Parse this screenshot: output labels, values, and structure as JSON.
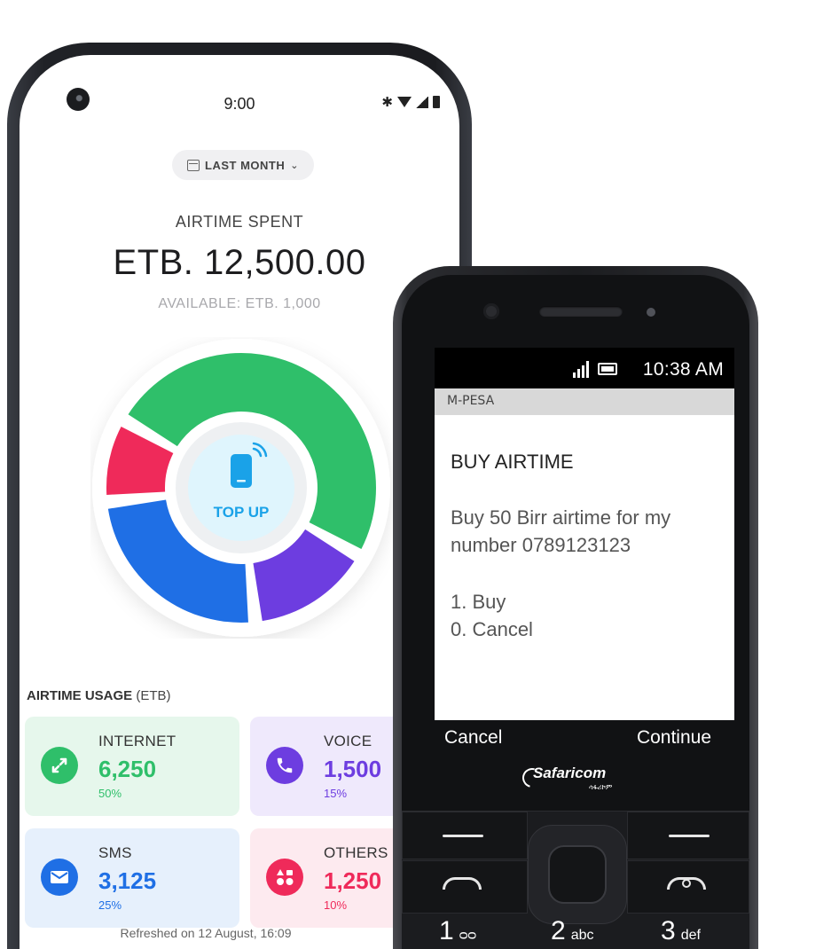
{
  "phone": {
    "status_time": "9:00",
    "period_label": "LAST MONTH",
    "spent_label": "AIRTIME SPENT",
    "spent_amount": "ETB. 12,500.00",
    "available": "AVAILABLE: ETB. 1,000",
    "topup_label": "TOP UP",
    "usage_heading": "AIRTIME USAGE",
    "usage_unit": "(ETB)",
    "refreshed": "Refreshed on 12 August, 16:09",
    "usage": [
      {
        "label": "INTERNET",
        "value": "6,250",
        "pct": "50%",
        "share": 0.5,
        "color": "#2fbf6a",
        "bg": "#e6f7ec",
        "icon": "swap-arrows-icon"
      },
      {
        "label": "VOICE",
        "value": "1,500",
        "pct": "15%",
        "share": 0.15,
        "color": "#6d3de0",
        "bg": "#efe9fc",
        "icon": "phone-icon"
      },
      {
        "label": "SMS",
        "value": "3,125",
        "pct": "25%",
        "share": 0.25,
        "color": "#1f6fe5",
        "bg": "#e6f0fc",
        "icon": "envelope-icon"
      },
      {
        "label": "OTHERS",
        "value": "1,250",
        "pct": "10%",
        "share": 0.1,
        "color": "#ef2a5a",
        "bg": "#fdeaef",
        "icon": "apps-icon"
      }
    ]
  },
  "feature_phone": {
    "time": "10:38 AM",
    "header": "M-PESA",
    "title": "BUY AIRTIME",
    "body": "Buy 50 Birr airtime for my number 0789123123",
    "option_1": "1. Buy",
    "option_0": "0. Cancel",
    "soft_left": "Cancel",
    "soft_right": "Continue",
    "brand": "Safaricom",
    "brand_sub": "ሳፋሪኮም",
    "keys": [
      {
        "digit": "1",
        "sub": "ᴑᴑ"
      },
      {
        "digit": "2",
        "sub": "abc"
      },
      {
        "digit": "3",
        "sub": "def"
      }
    ]
  }
}
